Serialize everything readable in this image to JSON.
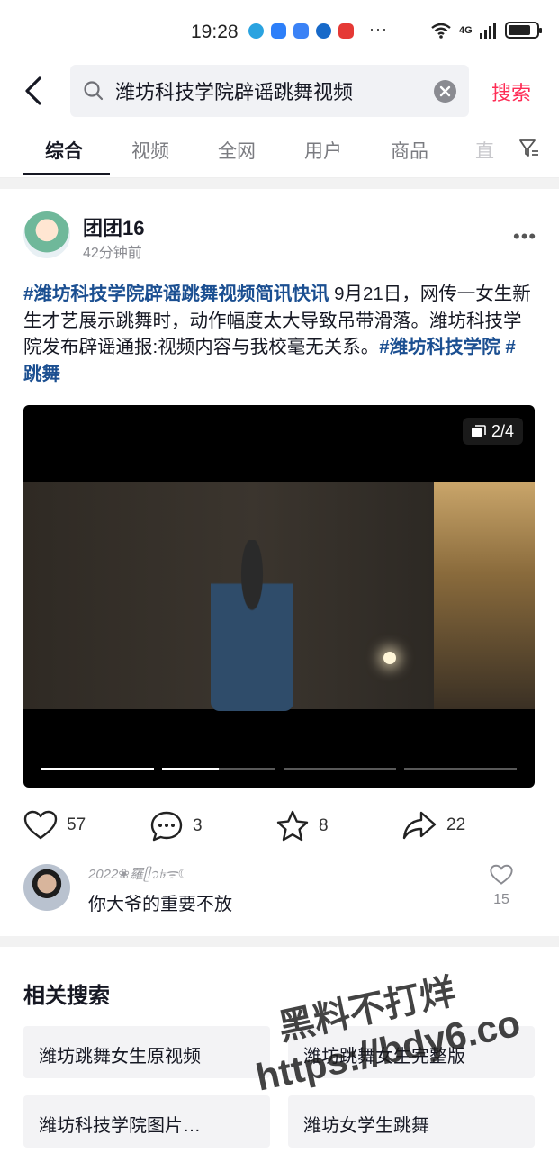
{
  "status_bar": {
    "time": "19:28",
    "network": "4G",
    "battery_level": 0.8,
    "more": "···"
  },
  "search": {
    "back_icon": "chevron-left-icon",
    "query": "潍坊科技学院辟谣跳舞视频",
    "submit_label": "搜索"
  },
  "tabs": [
    {
      "label": "综合",
      "active": true
    },
    {
      "label": "视频",
      "active": false
    },
    {
      "label": "全网",
      "active": false
    },
    {
      "label": "用户",
      "active": false
    },
    {
      "label": "商品",
      "active": false
    },
    {
      "label": "直",
      "active": false
    }
  ],
  "post": {
    "author": "团团16",
    "time": "42分钟前",
    "hashtag_main": "#潍坊科技学院辟谣跳舞视频简讯快讯",
    "body": " 9月21日，网传一女生新生才艺展示跳舞时，动作幅度太大导致吊带滑落。潍坊科技学院发布辟谣通报:视频内容与我校毫无关系。",
    "hashtag_school": "#潍坊科技学院",
    "hashtag_dance": "#跳舞",
    "media_page": "2/4",
    "media_progress": [
      1,
      0.5,
      0,
      0
    ],
    "likes": "57",
    "comments": "3",
    "favorites": "8",
    "shares": "22"
  },
  "top_comment": {
    "user": "2022❀羅ᥫ᭡৳ᯤ☾",
    "text": "你大爷的重要不放",
    "likes": "15"
  },
  "related": {
    "title": "相关搜索",
    "items": [
      "潍坊跳舞女生原视频",
      "潍坊跳舞女生完整版",
      "潍坊科技学院图片…",
      "潍坊女学生跳舞"
    ]
  },
  "watermark": {
    "line1": "黑料不打烊",
    "line2": "https://bdy6.co"
  },
  "colors": {
    "accent": "#fe2c55",
    "hashtag": "#1b4f91",
    "text": "#161823",
    "muted": "#8a8b91"
  }
}
